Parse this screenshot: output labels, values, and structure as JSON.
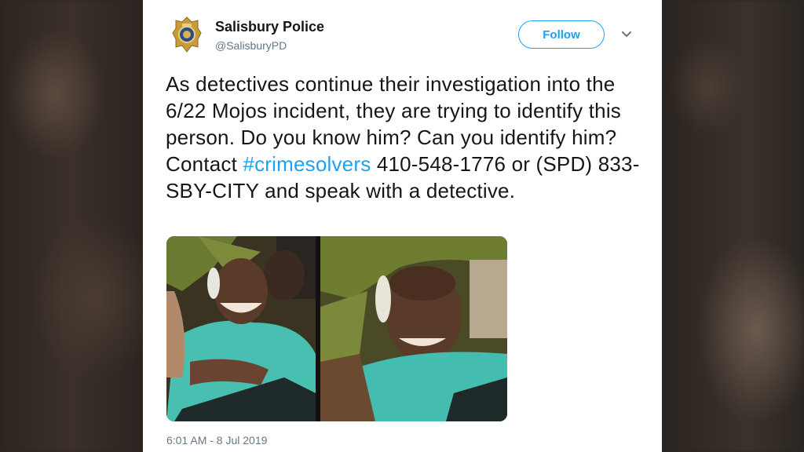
{
  "account": {
    "display_name": "Salisbury Police",
    "handle": "@SalisburyPD",
    "avatar_icon": "police-badge-icon"
  },
  "actions": {
    "follow_label": "Follow",
    "menu_icon": "chevron-down-icon"
  },
  "tweet": {
    "text_before_hashtag": "As detectives continue their investigation into the 6/22 Mojos incident, they are trying to identify this person. Do you know him? Can you identify him? Contact ",
    "hashtag": "#crimesolvers",
    "text_after_hashtag": " 410-548-1776 or (SPD) 833-SBY-CITY and speak with a detective.",
    "timestamp": "6:01 AM - 8 Jul 2019"
  },
  "media": {
    "photos": [
      {
        "name": "suspect-photo-1"
      },
      {
        "name": "suspect-photo-2"
      }
    ]
  },
  "colors": {
    "link": "#1da1f2",
    "text": "#14171a",
    "muted": "#657786",
    "background": "#ffffff"
  }
}
